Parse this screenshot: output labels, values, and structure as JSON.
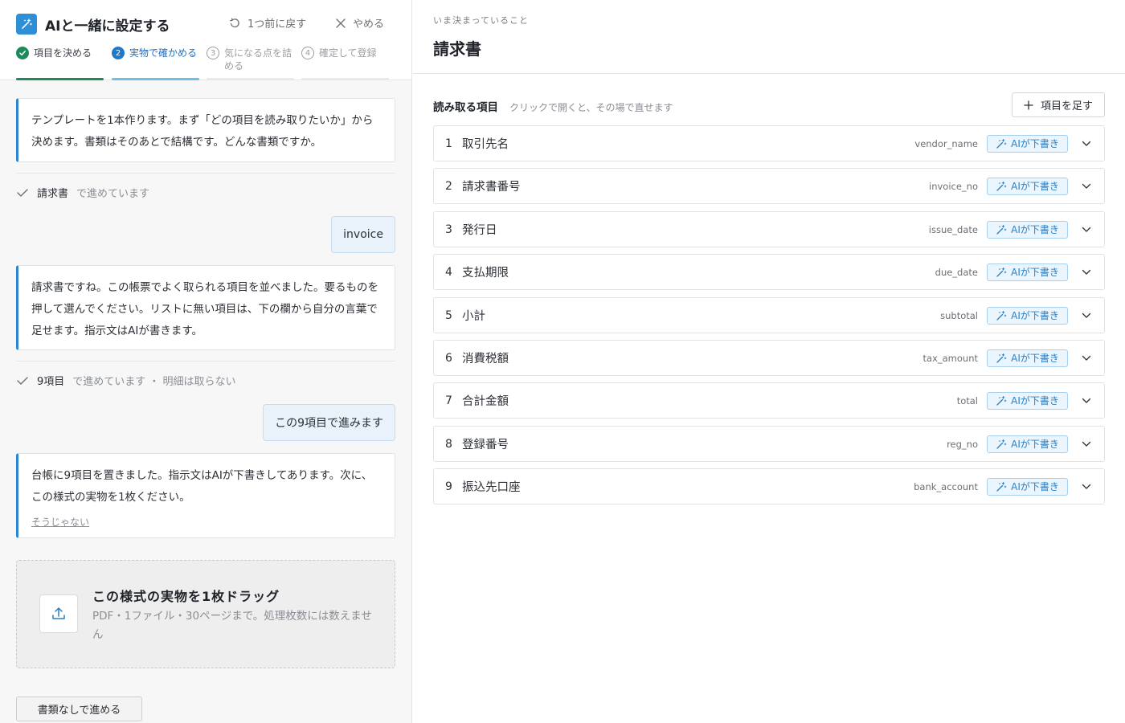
{
  "header": {
    "title": "AIと一緒に設定する",
    "back_label": "1つ前に戻す",
    "cancel_label": "やめる"
  },
  "steps": [
    {
      "num": "✓",
      "label": "項目を決める",
      "state": "done"
    },
    {
      "num": "2",
      "label": "実物で確かめる",
      "state": "active"
    },
    {
      "num": "3",
      "label": "気になる点を詰める",
      "state": "todo"
    },
    {
      "num": "4",
      "label": "確定して登録",
      "state": "todo"
    }
  ],
  "chat": {
    "ai_msg_1": "テンプレートを1本作ります。まず「どの項目を読み取りたいか」から決めます。書類はそのあとで結構です。どんな書類ですか。",
    "status_1": {
      "strong": "請求書",
      "muted": "で進めています"
    },
    "user_msg_1": "invoice",
    "ai_msg_2": "請求書ですね。この帳票でよく取られる項目を並べました。要るものを押して選んでください。リストに無い項目は、下の欄から自分の言葉で足せます。指示文はAIが書きます。",
    "status_2": {
      "strong": "9項目",
      "muted": "で進めています ・ 明細は取らない"
    },
    "user_msg_2": "この9項目で進みます",
    "ai_msg_3": "台帳に9項目を置きました。指示文はAIが下書きしてあります。次に、この様式の実物を1枚ください。",
    "undo_link": "そうじゃない"
  },
  "dropzone": {
    "title": "この様式の実物を1枚ドラッグ",
    "subtitle": "PDF・1ファイル・30ページまで。処理枚数には数えません"
  },
  "no_doc_button": "書類なしで進める",
  "right": {
    "eyebrow": "いま決まっていること",
    "doc_title": "請求書",
    "fields_title": "読み取る項目",
    "fields_hint": "クリックで開くと、その場で直せます",
    "add_button": "項目を足す",
    "ai_badge_label": "AIが下書き",
    "fields": [
      {
        "num": "1",
        "label": "取引先名",
        "key": "vendor_name"
      },
      {
        "num": "2",
        "label": "請求書番号",
        "key": "invoice_no"
      },
      {
        "num": "3",
        "label": "発行日",
        "key": "issue_date"
      },
      {
        "num": "4",
        "label": "支払期限",
        "key": "due_date"
      },
      {
        "num": "5",
        "label": "小計",
        "key": "subtotal"
      },
      {
        "num": "6",
        "label": "消費税額",
        "key": "tax_amount"
      },
      {
        "num": "7",
        "label": "合計金額",
        "key": "total"
      },
      {
        "num": "8",
        "label": "登録番号",
        "key": "reg_no"
      },
      {
        "num": "9",
        "label": "振込先口座",
        "key": "bank_account"
      }
    ]
  },
  "colors": {
    "accent": "#2a86d0",
    "done_green": "#1e8a5b",
    "active_blue": "#1f78c8",
    "user_bubble": "#e9f2fa"
  }
}
